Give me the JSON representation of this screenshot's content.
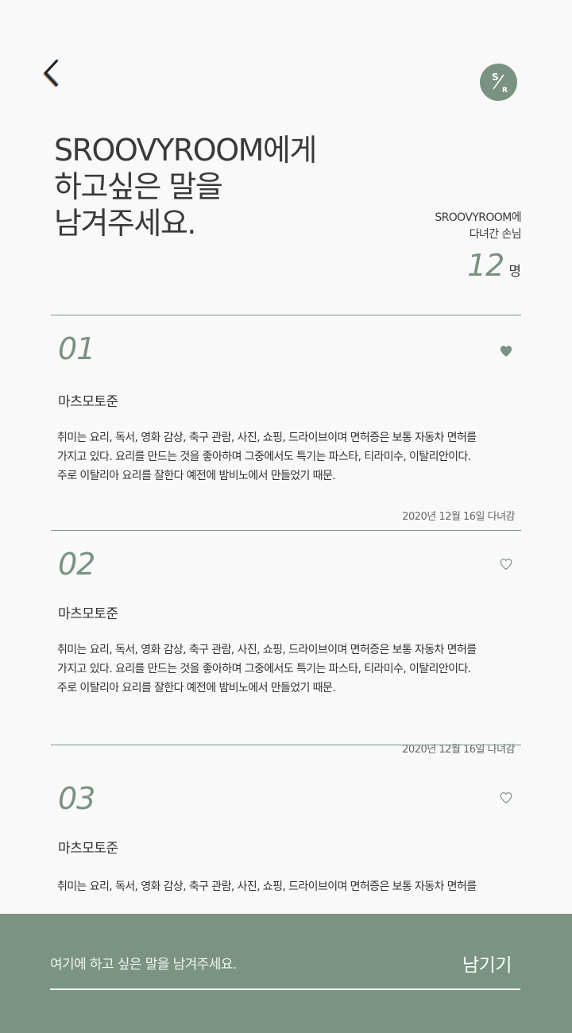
{
  "header": {
    "back_icon": "chevron-left-icon",
    "logo": {
      "top": "S",
      "bottom": "R",
      "color": "#799282"
    }
  },
  "title": {
    "lines": [
      "SROOVYROOM에게",
      "하고싶은 말을",
      "남겨주세요."
    ]
  },
  "visitors": {
    "label_lines": [
      "SROOVYROOM에",
      "다녀간 손님"
    ],
    "count": "12",
    "unit": "명"
  },
  "entries": [
    {
      "number": "01",
      "liked": true,
      "author": "마츠모토준",
      "body_lines": [
        "취미는 요리, 독서, 영화 감상, 축구 관람, 사진, 쇼핑, 드라이브이며 면허증은 보통 자동차 면허를",
        "가지고 있다. 요리를 만드는 것을 좋아하며 그중에서도 특기는 파스타, 티라미수, 이탈리안이다.",
        "주로 이탈리아 요리를 잘한다 예전에 밤비노에서 만들었기 때문."
      ],
      "date": "2020년 12월 16일 다녀감"
    },
    {
      "number": "02",
      "liked": false,
      "author": "마츠모토준",
      "body_lines": [
        "취미는 요리, 독서, 영화 감상, 축구 관람, 사진, 쇼핑, 드라이브이며 면허증은 보통 자동차 면허를",
        "가지고 있다. 요리를 만드는 것을 좋아하며 그중에서도 특기는 파스타, 티라미수, 이탈리안이다.",
        "주로 이탈리아 요리를 잘한다 예전에 밤비노에서 만들었기 때문."
      ],
      "date": "2020년 12월 16일 다녀감"
    },
    {
      "number": "03",
      "liked": false,
      "author": "마츠모토준",
      "body_lines": [
        "취미는 요리, 독서, 영화 감상, 축구 관람, 사진, 쇼핑, 드라이브이며 면허증은 보통 자동차 면허를"
      ]
    }
  ],
  "composer": {
    "placeholder": "여기에 하고 싶은 말을 남겨주세요.",
    "submit_label": "남기기"
  },
  "colors": {
    "accent": "#799282",
    "footer_bg": "#7a9382",
    "background": "#f9f9f9",
    "text": "#333333"
  }
}
